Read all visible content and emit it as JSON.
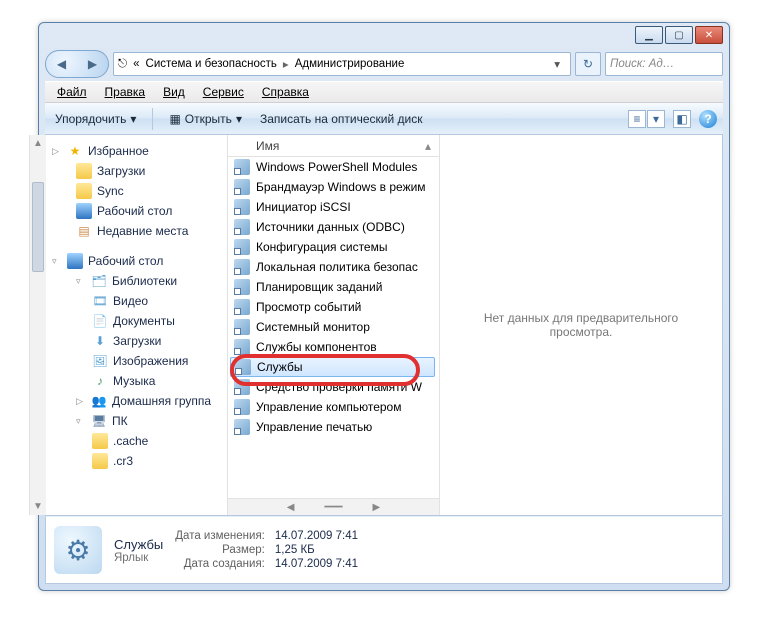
{
  "caption": {
    "min": "▁",
    "max": "▢",
    "close": "✕"
  },
  "address": {
    "icon": "⎋",
    "crumb_prefix": "«",
    "crumb1": "Система и безопасность",
    "sep": "▸",
    "crumb2": "Администрирование",
    "dropdown": "▾"
  },
  "refresh_glyph": "↻",
  "search": {
    "placeholder": "Поиск: Ад…",
    "icon": "🔍"
  },
  "menu": {
    "file": "Файл",
    "edit": "Правка",
    "view": "Вид",
    "tools": "Сервис",
    "help": "Справка"
  },
  "cmdbar": {
    "organize": "Упорядочить",
    "open_icon": "▦",
    "open": "Открыть",
    "burn": "Записать на оптический диск",
    "help_glyph": "?"
  },
  "tree": {
    "favorites": {
      "label": "Избранное",
      "items": [
        "Загрузки",
        "Sync",
        "Рабочий стол",
        "Недавние места"
      ],
      "twist": "▷"
    },
    "desktop": {
      "label": "Рабочий стол",
      "twist": "▿",
      "libraries": {
        "label": "Библиотеки",
        "twist": "▿",
        "items": [
          "Видео",
          "Документы",
          "Загрузки",
          "Изображения",
          "Музыка"
        ]
      },
      "homegroup": "Домашняя группа",
      "pc": {
        "label": "ПК",
        "twist": "▿",
        "items": [
          ".cache",
          ".cr3"
        ]
      }
    }
  },
  "list": {
    "header": "Имя",
    "sort_glyph": "▴",
    "items": [
      "Windows PowerShell Modules",
      "Брандмауэр Windows в режим",
      "Инициатор iSCSI",
      "Источники данных (ODBC)",
      "Конфигурация системы",
      "Локальная политика безопас",
      "Планировщик заданий",
      "Просмотр событий",
      "Системный монитор",
      "Службы компонентов",
      "Службы",
      "Средство проверки памяти W",
      "Управление компьютером",
      "Управление печатью"
    ],
    "selected_index": 10
  },
  "preview": {
    "empty_text": "Нет данных для предварительного просмотра."
  },
  "details": {
    "name": "Службы",
    "type": "Ярлык",
    "lbl_modified": "Дата изменения:",
    "val_modified": "14.07.2009 7:41",
    "lbl_size": "Размер:",
    "val_size": "1,25 КБ",
    "lbl_created": "Дата создания:",
    "val_created": "14.07.2009 7:41",
    "gear_glyph": "⚙"
  }
}
